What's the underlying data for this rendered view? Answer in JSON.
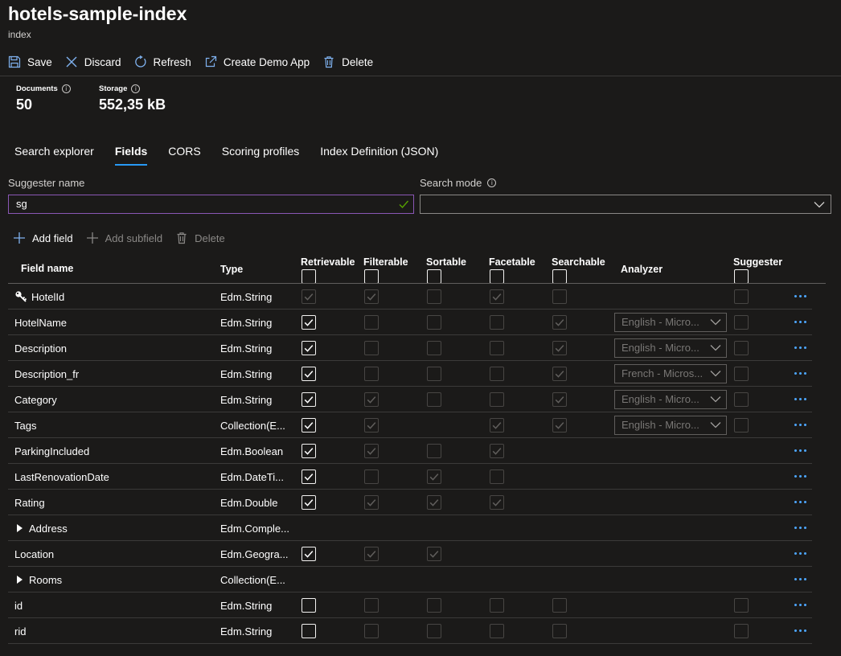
{
  "page": {
    "title": "hotels-sample-index",
    "subtitle": "index"
  },
  "toolbar": [
    {
      "label": "Save",
      "icon": "save-icon"
    },
    {
      "label": "Discard",
      "icon": "close-icon"
    },
    {
      "label": "Refresh",
      "icon": "refresh-icon"
    },
    {
      "label": "Create Demo App",
      "icon": "external-link-icon"
    },
    {
      "label": "Delete",
      "icon": "trash-icon"
    }
  ],
  "stats": {
    "documents": {
      "label": "Documents",
      "value": "50"
    },
    "storage": {
      "label": "Storage",
      "value": "552,35 kB"
    }
  },
  "tabs": [
    {
      "label": "Search explorer",
      "active": false
    },
    {
      "label": "Fields",
      "active": true
    },
    {
      "label": "CORS",
      "active": false
    },
    {
      "label": "Scoring profiles",
      "active": false
    },
    {
      "label": "Index Definition (JSON)",
      "active": false
    }
  ],
  "form": {
    "suggester_label": "Suggester name",
    "suggester_value": "sg",
    "search_mode_label": "Search mode",
    "search_mode_value": ""
  },
  "field_actions": [
    {
      "label": "Add field",
      "icon": "plus-icon",
      "disabled": false
    },
    {
      "label": "Add subfield",
      "icon": "plus-icon",
      "disabled": true
    },
    {
      "label": "Delete",
      "icon": "trash-icon",
      "disabled": true
    }
  ],
  "columns": {
    "name": "Field name",
    "type": "Type",
    "retrievable": "Retrievable",
    "filterable": "Filterable",
    "sortable": "Sortable",
    "facetable": "Facetable",
    "searchable": "Searchable",
    "analyzer": "Analyzer",
    "suggester": "Suggester"
  },
  "colors": {
    "background": "#1b1a19",
    "accent": "#2899f5",
    "focus_border": "#8a57b5",
    "more_dots": "#4da6ff",
    "valid_check": "#57a300"
  },
  "fields": [
    {
      "name": "HotelId",
      "type": "Edm.String",
      "key": true,
      "retrievable": {
        "c": true,
        "s": "dis"
      },
      "filterable": {
        "c": true,
        "s": "dis"
      },
      "sortable": {
        "c": false,
        "s": "dis"
      },
      "facetable": {
        "c": true,
        "s": "dis"
      },
      "searchable": {
        "c": false,
        "s": "dis"
      },
      "analyzer": null,
      "suggester": {
        "c": false,
        "s": "dis"
      }
    },
    {
      "name": "HotelName",
      "type": "Edm.String",
      "retrievable": {
        "c": true,
        "s": "en"
      },
      "filterable": {
        "c": false,
        "s": "dis"
      },
      "sortable": {
        "c": false,
        "s": "dis"
      },
      "facetable": {
        "c": false,
        "s": "dis"
      },
      "searchable": {
        "c": true,
        "s": "dis"
      },
      "analyzer": "English - Micro...",
      "suggester": {
        "c": false,
        "s": "dis"
      }
    },
    {
      "name": "Description",
      "type": "Edm.String",
      "retrievable": {
        "c": true,
        "s": "en"
      },
      "filterable": {
        "c": false,
        "s": "dis"
      },
      "sortable": {
        "c": false,
        "s": "dis"
      },
      "facetable": {
        "c": false,
        "s": "dis"
      },
      "searchable": {
        "c": true,
        "s": "dis"
      },
      "analyzer": "English - Micro...",
      "suggester": {
        "c": false,
        "s": "dis"
      }
    },
    {
      "name": "Description_fr",
      "type": "Edm.String",
      "retrievable": {
        "c": true,
        "s": "en"
      },
      "filterable": {
        "c": false,
        "s": "dis"
      },
      "sortable": {
        "c": false,
        "s": "dis"
      },
      "facetable": {
        "c": false,
        "s": "dis"
      },
      "searchable": {
        "c": true,
        "s": "dis"
      },
      "analyzer": "French - Micros...",
      "suggester": {
        "c": false,
        "s": "dis"
      }
    },
    {
      "name": "Category",
      "type": "Edm.String",
      "retrievable": {
        "c": true,
        "s": "en"
      },
      "filterable": {
        "c": true,
        "s": "dis"
      },
      "sortable": {
        "c": false,
        "s": "dis"
      },
      "facetable": {
        "c": false,
        "s": "dis"
      },
      "searchable": {
        "c": true,
        "s": "dis"
      },
      "analyzer": "English - Micro...",
      "suggester": {
        "c": false,
        "s": "dis"
      }
    },
    {
      "name": "Tags",
      "type": "Collection(E...",
      "retrievable": {
        "c": true,
        "s": "en"
      },
      "filterable": {
        "c": true,
        "s": "dis"
      },
      "sortable": null,
      "facetable": {
        "c": true,
        "s": "dis"
      },
      "searchable": {
        "c": true,
        "s": "dis"
      },
      "analyzer": "English - Micro...",
      "suggester": {
        "c": false,
        "s": "dis"
      }
    },
    {
      "name": "ParkingIncluded",
      "type": "Edm.Boolean",
      "retrievable": {
        "c": true,
        "s": "en"
      },
      "filterable": {
        "c": true,
        "s": "dis"
      },
      "sortable": {
        "c": false,
        "s": "dis"
      },
      "facetable": {
        "c": true,
        "s": "dis"
      },
      "searchable": null,
      "analyzer": null,
      "suggester": null
    },
    {
      "name": "LastRenovationDate",
      "type": "Edm.DateTi...",
      "retrievable": {
        "c": true,
        "s": "en"
      },
      "filterable": {
        "c": false,
        "s": "dis"
      },
      "sortable": {
        "c": true,
        "s": "dis"
      },
      "facetable": {
        "c": false,
        "s": "dis"
      },
      "searchable": null,
      "analyzer": null,
      "suggester": null
    },
    {
      "name": "Rating",
      "type": "Edm.Double",
      "retrievable": {
        "c": true,
        "s": "en"
      },
      "filterable": {
        "c": true,
        "s": "dis"
      },
      "sortable": {
        "c": true,
        "s": "dis"
      },
      "facetable": {
        "c": true,
        "s": "dis"
      },
      "searchable": null,
      "analyzer": null,
      "suggester": null
    },
    {
      "name": "Address",
      "type": "Edm.Comple...",
      "expandable": true,
      "retrievable": null,
      "filterable": null,
      "sortable": null,
      "facetable": null,
      "searchable": null,
      "analyzer": null,
      "suggester": null
    },
    {
      "name": "Location",
      "type": "Edm.Geogra...",
      "retrievable": {
        "c": true,
        "s": "en"
      },
      "filterable": {
        "c": true,
        "s": "dis"
      },
      "sortable": {
        "c": true,
        "s": "dis"
      },
      "facetable": null,
      "searchable": null,
      "analyzer": null,
      "suggester": null
    },
    {
      "name": "Rooms",
      "type": "Collection(E...",
      "expandable": true,
      "retrievable": null,
      "filterable": null,
      "sortable": null,
      "facetable": null,
      "searchable": null,
      "analyzer": null,
      "suggester": null
    },
    {
      "name": "id",
      "type": "Edm.String",
      "retrievable": {
        "c": false,
        "s": "en"
      },
      "filterable": {
        "c": false,
        "s": "dis"
      },
      "sortable": {
        "c": false,
        "s": "dis"
      },
      "facetable": {
        "c": false,
        "s": "dis"
      },
      "searchable": {
        "c": false,
        "s": "dis"
      },
      "analyzer": null,
      "suggester": {
        "c": false,
        "s": "dis"
      }
    },
    {
      "name": "rid",
      "type": "Edm.String",
      "retrievable": {
        "c": false,
        "s": "en"
      },
      "filterable": {
        "c": false,
        "s": "dis"
      },
      "sortable": {
        "c": false,
        "s": "dis"
      },
      "facetable": {
        "c": false,
        "s": "dis"
      },
      "searchable": {
        "c": false,
        "s": "dis"
      },
      "analyzer": null,
      "suggester": {
        "c": false,
        "s": "dis"
      }
    }
  ]
}
